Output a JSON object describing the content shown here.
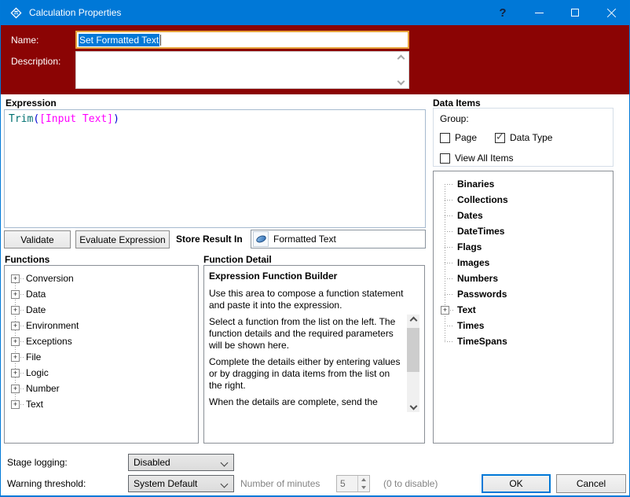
{
  "window": {
    "title": "Calculation Properties",
    "help_glyph": "?"
  },
  "header": {
    "name_label": "Name:",
    "name_value": "Set Formatted Text",
    "description_label": "Description:",
    "description_value": ""
  },
  "expression": {
    "label": "Expression",
    "value": "Trim([Input Text])",
    "tokens": [
      {
        "text": "Trim",
        "type": "function"
      },
      {
        "text": "(",
        "type": "paren"
      },
      {
        "text": "[Input Text]",
        "type": "data-item"
      },
      {
        "text": ")",
        "type": "paren"
      }
    ]
  },
  "actions": {
    "validate": "Validate",
    "evaluate": "Evaluate Expression",
    "store_result_in": "Store Result In",
    "store_target": "Formatted Text"
  },
  "functions": {
    "label": "Functions",
    "items": [
      "Conversion",
      "Data",
      "Date",
      "Environment",
      "Exceptions",
      "File",
      "Logic",
      "Number",
      "Text"
    ]
  },
  "function_detail": {
    "label": "Function Detail",
    "title": "Expression Function Builder",
    "intro": "Use this area to compose a function statement and paste it into the expression.",
    "paragraphs": [
      "Select a function from the list on the left. The function details and the required parameters will be shown here.",
      "Complete the details either by entering values or by dragging in data items from the list on the right.",
      "When the details are complete, send the"
    ]
  },
  "data_items": {
    "label": "Data Items",
    "group_label": "Group:",
    "checkboxes": [
      {
        "label": "Page",
        "checked": false
      },
      {
        "label": "Data Type",
        "checked": true
      },
      {
        "label": "View All Items",
        "checked": false
      }
    ],
    "check_glyph": "✓",
    "expander_glyph": "+",
    "tree": [
      "Binaries",
      "Collections",
      "Dates",
      "DateTimes",
      "Flags",
      "Images",
      "Numbers",
      "Passwords",
      "Text",
      "Times",
      "TimeSpans"
    ]
  },
  "footer": {
    "stage_logging_label": "Stage logging:",
    "stage_logging_value": "Disabled",
    "warning_threshold_label": "Warning threshold:",
    "warning_threshold_value": "System Default",
    "minutes_label": "Number of minutes",
    "minutes_value": "5",
    "disable_hint": "(0 to disable)",
    "ok": "OK",
    "cancel": "Cancel"
  },
  "colors": {
    "titlebar": "#0078D7",
    "header_background": "#8B0404",
    "name_field_border": "#E8A33D",
    "text_selection": "#0078D7",
    "expression_function": "#007070",
    "expression_paren": "#0000D4",
    "expression_data_item": "#FF00FF",
    "ok_focus_border": "#0078D7"
  }
}
